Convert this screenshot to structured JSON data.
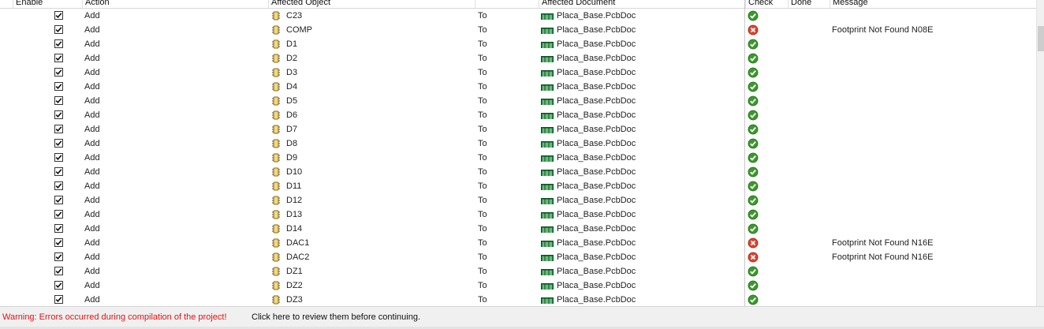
{
  "columns": {
    "enable": "Enable",
    "action": "Action",
    "affected_object": "Affected Object",
    "affected_document": "Affected Document",
    "check": "Check",
    "done": "Done",
    "message": "Message"
  },
  "rows": [
    {
      "enabled": true,
      "action": "Add",
      "object": "C23",
      "to": "To",
      "document": "Placa_Base.PcbDoc",
      "check": "ok",
      "message": ""
    },
    {
      "enabled": true,
      "action": "Add",
      "object": "COMP",
      "to": "To",
      "document": "Placa_Base.PcbDoc",
      "check": "error",
      "message": "Footprint Not Found N08E"
    },
    {
      "enabled": true,
      "action": "Add",
      "object": "D1",
      "to": "To",
      "document": "Placa_Base.PcbDoc",
      "check": "ok",
      "message": ""
    },
    {
      "enabled": true,
      "action": "Add",
      "object": "D2",
      "to": "To",
      "document": "Placa_Base.PcbDoc",
      "check": "ok",
      "message": ""
    },
    {
      "enabled": true,
      "action": "Add",
      "object": "D3",
      "to": "To",
      "document": "Placa_Base.PcbDoc",
      "check": "ok",
      "message": ""
    },
    {
      "enabled": true,
      "action": "Add",
      "object": "D4",
      "to": "To",
      "document": "Placa_Base.PcbDoc",
      "check": "ok",
      "message": ""
    },
    {
      "enabled": true,
      "action": "Add",
      "object": "D5",
      "to": "To",
      "document": "Placa_Base.PcbDoc",
      "check": "ok",
      "message": ""
    },
    {
      "enabled": true,
      "action": "Add",
      "object": "D6",
      "to": "To",
      "document": "Placa_Base.PcbDoc",
      "check": "ok",
      "message": ""
    },
    {
      "enabled": true,
      "action": "Add",
      "object": "D7",
      "to": "To",
      "document": "Placa_Base.PcbDoc",
      "check": "ok",
      "message": ""
    },
    {
      "enabled": true,
      "action": "Add",
      "object": "D8",
      "to": "To",
      "document": "Placa_Base.PcbDoc",
      "check": "ok",
      "message": ""
    },
    {
      "enabled": true,
      "action": "Add",
      "object": "D9",
      "to": "To",
      "document": "Placa_Base.PcbDoc",
      "check": "ok",
      "message": ""
    },
    {
      "enabled": true,
      "action": "Add",
      "object": "D10",
      "to": "To",
      "document": "Placa_Base.PcbDoc",
      "check": "ok",
      "message": ""
    },
    {
      "enabled": true,
      "action": "Add",
      "object": "D11",
      "to": "To",
      "document": "Placa_Base.PcbDoc",
      "check": "ok",
      "message": ""
    },
    {
      "enabled": true,
      "action": "Add",
      "object": "D12",
      "to": "To",
      "document": "Placa_Base.PcbDoc",
      "check": "ok",
      "message": ""
    },
    {
      "enabled": true,
      "action": "Add",
      "object": "D13",
      "to": "To",
      "document": "Placa_Base.PcbDoc",
      "check": "ok",
      "message": ""
    },
    {
      "enabled": true,
      "action": "Add",
      "object": "D14",
      "to": "To",
      "document": "Placa_Base.PcbDoc",
      "check": "ok",
      "message": ""
    },
    {
      "enabled": true,
      "action": "Add",
      "object": "DAC1",
      "to": "To",
      "document": "Placa_Base.PcbDoc",
      "check": "error",
      "message": "Footprint Not Found N16E"
    },
    {
      "enabled": true,
      "action": "Add",
      "object": "DAC2",
      "to": "To",
      "document": "Placa_Base.PcbDoc",
      "check": "error",
      "message": "Footprint Not Found N16E"
    },
    {
      "enabled": true,
      "action": "Add",
      "object": "DZ1",
      "to": "To",
      "document": "Placa_Base.PcbDoc",
      "check": "ok",
      "message": ""
    },
    {
      "enabled": true,
      "action": "Add",
      "object": "DZ2",
      "to": "To",
      "document": "Placa_Base.PcbDoc",
      "check": "ok",
      "message": ""
    },
    {
      "enabled": true,
      "action": "Add",
      "object": "DZ3",
      "to": "To",
      "document": "Placa_Base.PcbDoc",
      "check": "ok",
      "message": ""
    }
  ],
  "status": {
    "warning": "Warning: Errors occurred during compilation of the project!",
    "link": "Click here to review them before continuing."
  },
  "colors": {
    "warning_text": "#e81010",
    "check_ok": "#3a9a2a",
    "check_error": "#e0442a"
  },
  "icons": {
    "object": "component-icon",
    "document": "pcb-document-icon",
    "ok": "check-ok-icon",
    "error": "check-error-icon"
  }
}
